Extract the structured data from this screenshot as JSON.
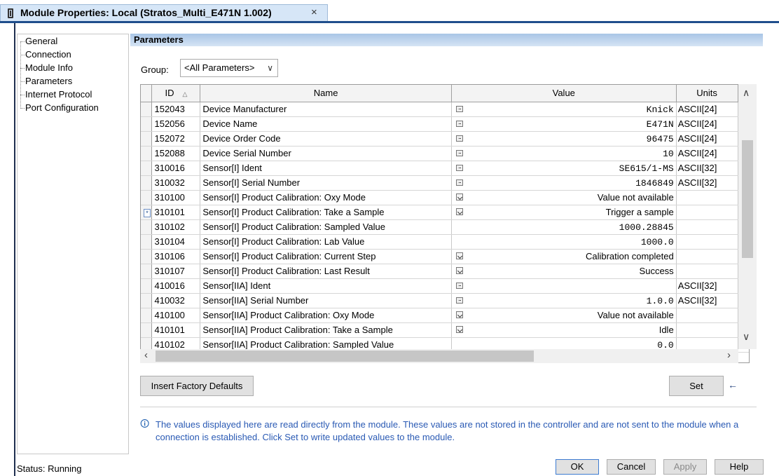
{
  "window": {
    "title": "Module Properties: Local (Stratos_Multi_E471N 1.002)",
    "close_glyph": "×"
  },
  "tree": {
    "items": [
      "General",
      "Connection",
      "Module Info",
      "Parameters",
      "Internet Protocol",
      "Port Configuration"
    ]
  },
  "section": {
    "title": "Parameters"
  },
  "group": {
    "label": "Group:",
    "value": "<All Parameters>"
  },
  "grid": {
    "columns": [
      "ID",
      "Name",
      "Value",
      "Units"
    ],
    "sort_indicator": "△",
    "rows": [
      {
        "marker": "",
        "id": "152043",
        "name": "Device Manufacturer",
        "editor": "ellipsis",
        "value": "Knick",
        "mono": true,
        "units": "ASCII[24]"
      },
      {
        "marker": "",
        "id": "152056",
        "name": "Device Name",
        "editor": "ellipsis",
        "value": "E471N",
        "mono": true,
        "units": "ASCII[24]"
      },
      {
        "marker": "",
        "id": "152072",
        "name": "Device Order Code",
        "editor": "ellipsis",
        "value": "96475",
        "mono": true,
        "units": "ASCII[24]"
      },
      {
        "marker": "",
        "id": "152088",
        "name": "Device Serial Number",
        "editor": "ellipsis",
        "value": "10",
        "mono": true,
        "units": "ASCII[24]"
      },
      {
        "marker": "",
        "id": "310016",
        "name": "Sensor[I] Ident",
        "editor": "ellipsis",
        "value": "SE615/1-MS",
        "mono": true,
        "units": "ASCII[32]"
      },
      {
        "marker": "",
        "id": "310032",
        "name": "Sensor[I] Serial Number",
        "editor": "ellipsis",
        "value": "1846849",
        "mono": true,
        "units": "ASCII[32]"
      },
      {
        "marker": "",
        "id": "310100",
        "name": "Sensor[I] Product Calibration: Oxy Mode",
        "editor": "dropdown",
        "value": "Value not available",
        "mono": false,
        "units": ""
      },
      {
        "marker": "*",
        "id": "310101",
        "name": "Sensor[I] Product Calibration: Take a Sample",
        "editor": "dropdown",
        "value": "Trigger a sample",
        "mono": false,
        "units": ""
      },
      {
        "marker": "",
        "id": "310102",
        "name": "Sensor[I] Product Calibration: Sampled Value",
        "editor": "none",
        "value": "1000.28845",
        "mono": true,
        "units": ""
      },
      {
        "marker": "",
        "id": "310104",
        "name": "Sensor[I] Product Calibration: Lab Value",
        "editor": "none",
        "value": "1000.0",
        "mono": true,
        "units": ""
      },
      {
        "marker": "",
        "id": "310106",
        "name": "Sensor[I] Product Calibration: Current Step",
        "editor": "dropdown",
        "value": "Calibration completed",
        "mono": false,
        "units": ""
      },
      {
        "marker": "",
        "id": "310107",
        "name": "Sensor[I] Product Calibration: Last Result",
        "editor": "dropdown",
        "value": "Success",
        "mono": false,
        "units": ""
      },
      {
        "marker": "",
        "id": "410016",
        "name": "Sensor[IIA] Ident",
        "editor": "ellipsis",
        "value": "",
        "mono": true,
        "units": "ASCII[32]"
      },
      {
        "marker": "",
        "id": "410032",
        "name": "Sensor[IIA] Serial Number",
        "editor": "ellipsis",
        "value": "1.0.0",
        "mono": true,
        "units": "ASCII[32]"
      },
      {
        "marker": "",
        "id": "410100",
        "name": "Sensor[IIA] Product Calibration: Oxy Mode",
        "editor": "dropdown",
        "value": "Value not available",
        "mono": false,
        "units": ""
      },
      {
        "marker": "",
        "id": "410101",
        "name": "Sensor[IIA] Product Calibration: Take a Sample",
        "editor": "dropdown",
        "value": "Idle",
        "mono": false,
        "units": ""
      },
      {
        "marker": "",
        "id": "410102",
        "name": "Sensor[IIA] Product Calibration: Sampled Value",
        "editor": "none",
        "value": "0.0",
        "mono": true,
        "units": ""
      }
    ]
  },
  "buttons": {
    "insert_defaults": "Insert Factory Defaults",
    "set": "Set",
    "set_arrow": "←",
    "ok": "OK",
    "cancel": "Cancel",
    "apply": "Apply",
    "help": "Help"
  },
  "info": {
    "icon": "i",
    "text": "The values displayed here are read directly from the module. These values are not stored in the controller and are not sent to the module when a connection is established.  Click Set to write updated values to the module."
  },
  "status": {
    "text": "Status:  Running"
  },
  "colors": {
    "accent": "#1f4e8c",
    "header_bar": "#a9c5e6",
    "info_text": "#2a5ab4"
  }
}
